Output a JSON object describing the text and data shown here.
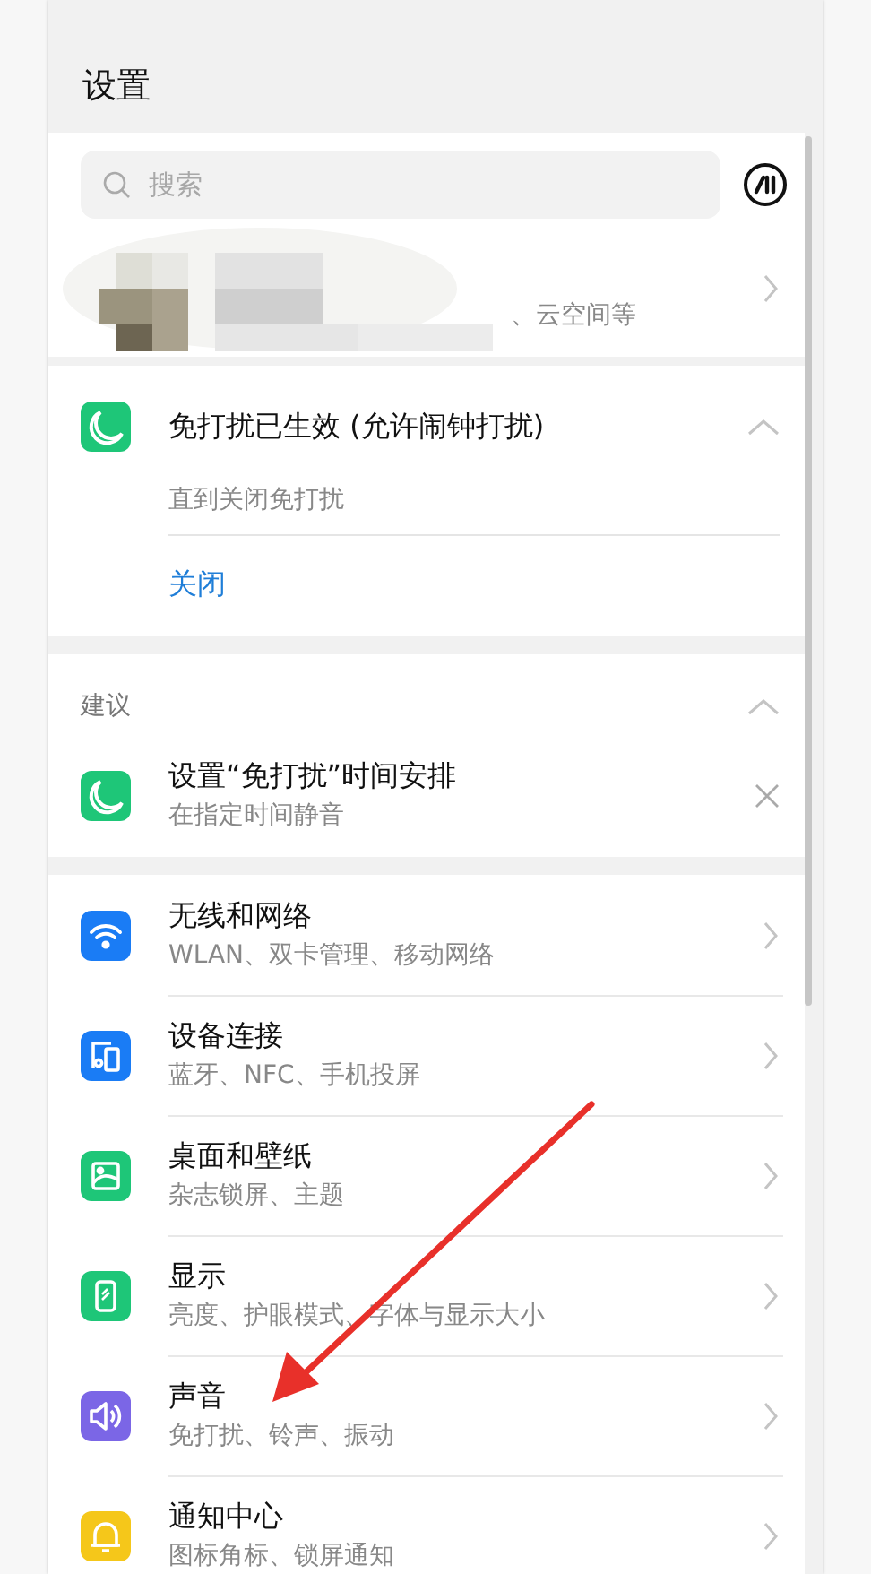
{
  "title": "设置",
  "search": {
    "placeholder": "搜索"
  },
  "account": {
    "kind": "picture",
    "subtitle": "、云空间等"
  },
  "dnd": {
    "title": "免打扰已生效 (允许闹钟打扰)",
    "expanded": true,
    "detail": "直到关闭免打扰",
    "action": "关闭"
  },
  "suggestions": {
    "heading": "建议",
    "expanded": true,
    "items": [
      {
        "kind": "moon",
        "color": "#1ec678",
        "title": "设置“免打扰”时间安排",
        "subtitle": "在指定时间静音"
      }
    ]
  },
  "settings": [
    {
      "kind": "wifi",
      "color": "#1a7cf5",
      "title": "无线和网络",
      "subtitle": "WLAN、双卡管理、移动网络"
    },
    {
      "kind": "devices",
      "color": "#1a7cf5",
      "title": "设备连接",
      "subtitle": "蓝牙、NFC、手机投屏"
    },
    {
      "kind": "wallpaper",
      "color": "#1ec678",
      "title": "桌面和壁纸",
      "subtitle": "杂志锁屏、主题"
    },
    {
      "kind": "display",
      "color": "#1ec678",
      "title": "显示",
      "subtitle": "亮度、护眼模式、字体与显示大小"
    },
    {
      "kind": "sound",
      "color": "#7b66e6",
      "title": "声音",
      "subtitle": "免打扰、铃声、振动"
    },
    {
      "kind": "bell",
      "color": "#f5c71a",
      "title": "通知中心",
      "subtitle": "图标角标、锁屏通知"
    }
  ]
}
